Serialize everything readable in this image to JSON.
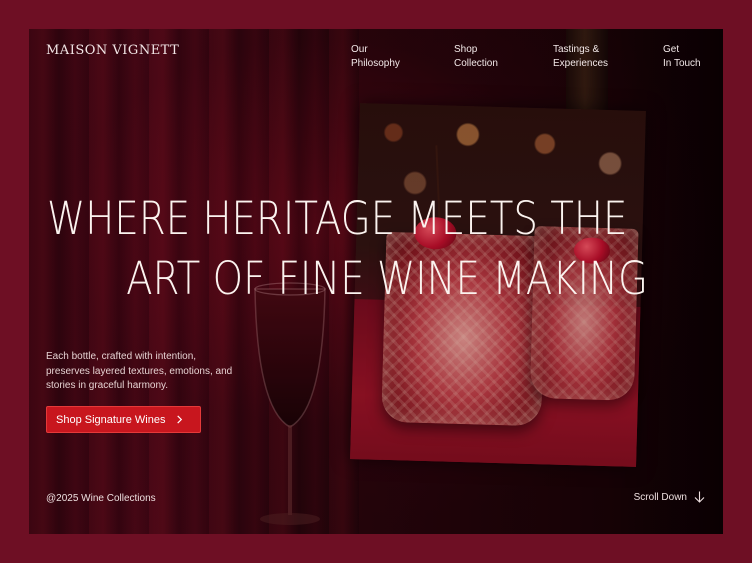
{
  "brand": {
    "logo_text": "MAISON VIGNETT"
  },
  "nav": {
    "items": [
      {
        "label": "Our\nPhilosophy"
      },
      {
        "label": "Shop\nCollection"
      },
      {
        "label": "Tastings &\nExperiences"
      },
      {
        "label": "Get\nIn Touch"
      }
    ]
  },
  "hero": {
    "title_line1": "WHERE HERITAGE MEETS THE",
    "title_line2": "ART OF FINE WINE MAKING",
    "description": "Each bottle, crafted with intention, preserves layered textures, emotions, and stories in graceful harmony.",
    "cta_label": "Shop Signature Wines"
  },
  "footer": {
    "copyright": "@2025 Wine Collections",
    "scroll_label": "Scroll Down"
  },
  "colors": {
    "outer_bg": "#6e0f24",
    "cta_bg": "#c8161e",
    "text_light": "#fbf3ef"
  },
  "icons": {
    "cta_icon": "chevron-right-icon",
    "scroll_icon": "arrow-down-icon"
  }
}
